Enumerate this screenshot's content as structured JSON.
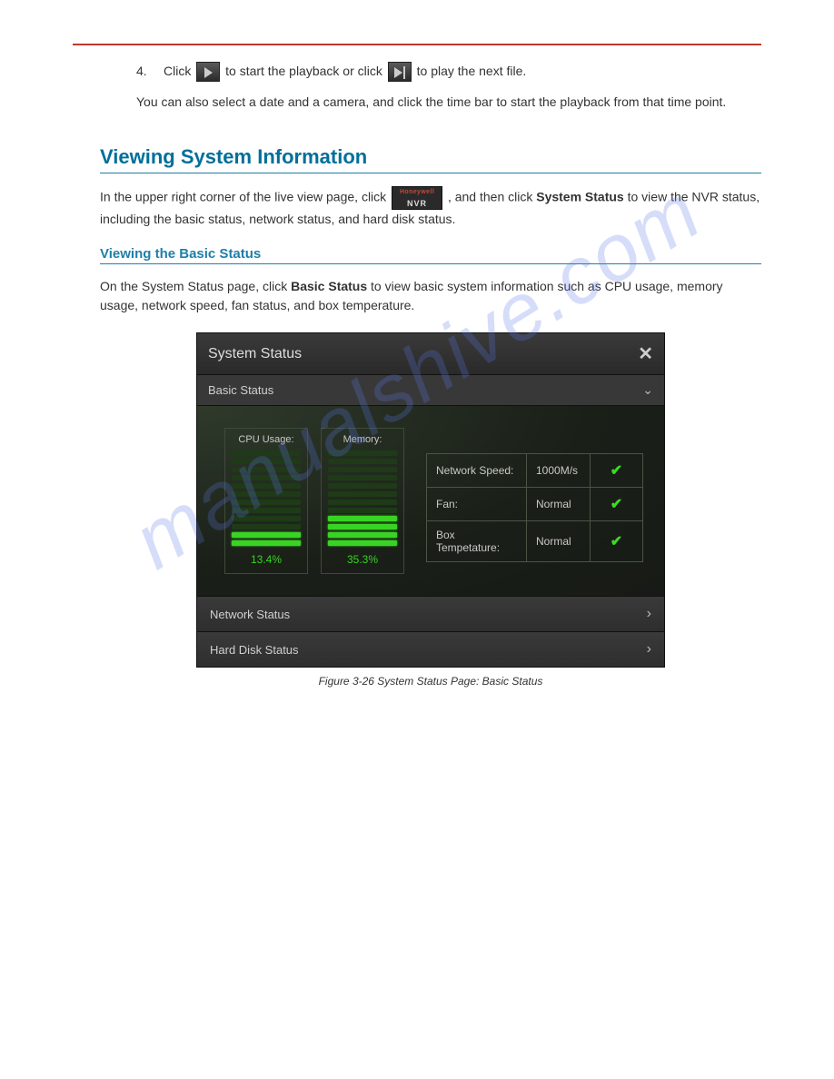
{
  "step": {
    "num": "4.",
    "prefix": "Click ",
    "mid": " to start the playback or click ",
    "suffix": " to play the next file."
  },
  "note": "You can also select a date and a camera, and click the time bar to start the playback from that time point.",
  "h2": "Viewing System Information",
  "intro_prefix": "In the upper right corner of the live view page, click ",
  "intro_suffix_1": ", and then click ",
  "intro_bold": "System Status",
  "intro_suffix_2": " to view the NVR status, including the basic status, network status, and hard disk status.",
  "badge_top": "Honeywell",
  "badge_bot": "NVR",
  "h3": "Viewing the Basic Status",
  "sub_prefix": "On the System Status page, click ",
  "sub_bold": "Basic Status",
  "sub_suffix": " to view basic system information such as CPU usage, memory usage, network speed, fan status, and box temperature.",
  "caption": "Figure 3-26 System Status Page: Basic Status",
  "watermark": "manualshive.com",
  "ss": {
    "title": "System Status",
    "section_basic": "Basic Status",
    "cpu_label": "CPU Usage:",
    "cpu_value": "13.4%",
    "cpu_on_bars": 2,
    "mem_label": "Memory:",
    "mem_value": "35.3%",
    "mem_on_bars": 4,
    "total_bars": 12,
    "rows": [
      {
        "label": "Network Speed:",
        "value": "1000M/s"
      },
      {
        "label": "Fan:",
        "value": "Normal"
      },
      {
        "label": "Box Tempetature:",
        "value": "Normal"
      }
    ],
    "row_network": "Network Status",
    "row_hdd": "Hard Disk Status"
  }
}
